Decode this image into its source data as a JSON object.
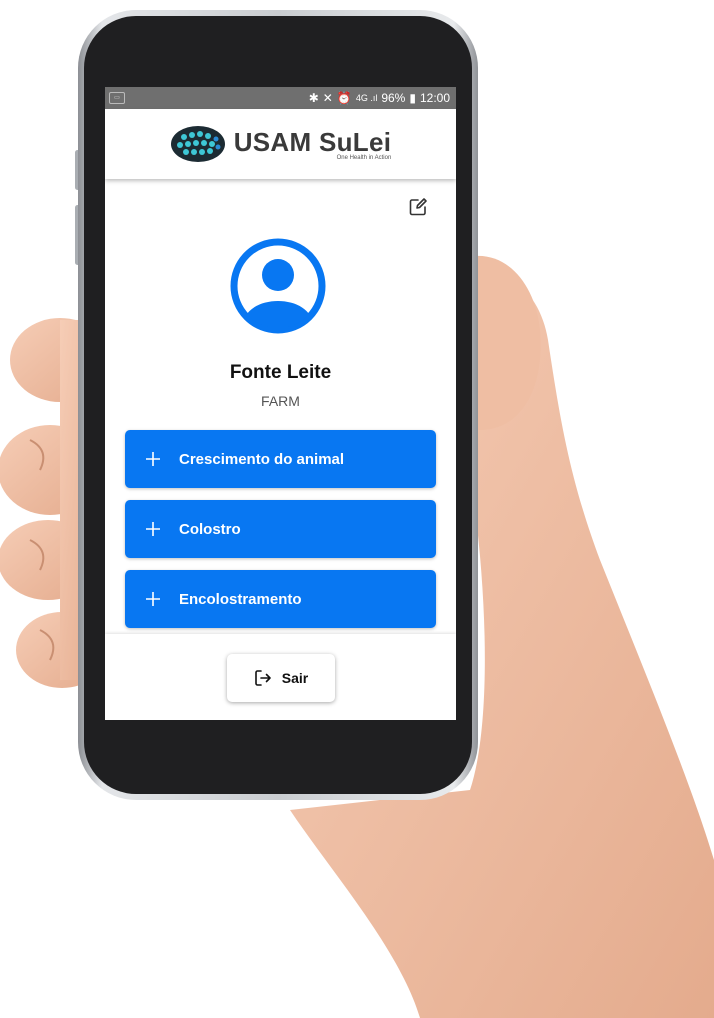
{
  "status_bar": {
    "left_icon": "notification-icon",
    "battery": "96%",
    "time": "12:00",
    "icons": [
      "bluetooth-icon",
      "mute-icon",
      "alarm-icon",
      "signal-4g-icon",
      "battery-icon"
    ]
  },
  "header": {
    "title": "USAM SuLei",
    "tagline": "One Health in Action"
  },
  "profile": {
    "name": "Fonte Leite",
    "role": "FARM",
    "edit_icon": "edit-icon"
  },
  "menu": [
    {
      "label": "Crescimento do animal"
    },
    {
      "label": "Colostro"
    },
    {
      "label": "Encolostramento"
    }
  ],
  "footer": {
    "logout_label": "Sair"
  },
  "colors": {
    "accent": "#0877f2",
    "status_bar": "#6f6f6f",
    "logo_dark": "#1c2b33",
    "logo_dots": "#3ec7d6"
  }
}
